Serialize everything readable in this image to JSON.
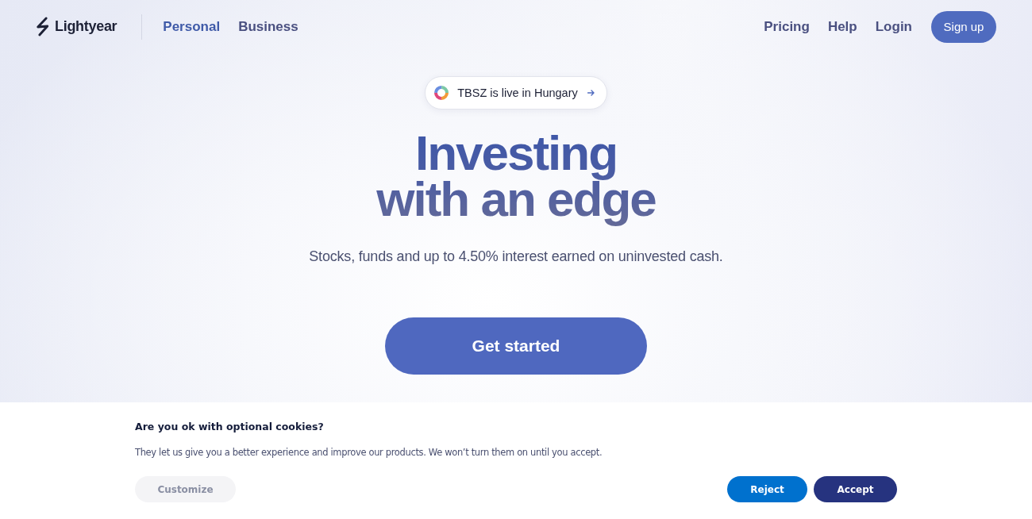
{
  "header": {
    "logo": "Lightyear",
    "nav": [
      {
        "label": "Personal",
        "selected": true
      },
      {
        "label": "Business",
        "selected": false
      }
    ],
    "links": [
      "Pricing",
      "Help",
      "Login"
    ],
    "signup": "Sign up"
  },
  "hero": {
    "badge": "TBSZ is live in Hungary",
    "title_lines": [
      "Investing",
      "with an edge"
    ],
    "subtitle": "Stocks, funds and up to 4.50% interest earned on uninvested cash.",
    "cta": "Get started"
  },
  "cookie_banner": {
    "title": "Are you ok with optional cookies?",
    "text": "They let us give you a better experience and improve our products. We won’t turn them on until you accept.",
    "buttons": [
      {
        "label": "Customize",
        "kind": "secondary"
      },
      {
        "label": "Reject",
        "kind": "reject"
      },
      {
        "label": "Accept",
        "kind": "accept"
      }
    ]
  }
}
